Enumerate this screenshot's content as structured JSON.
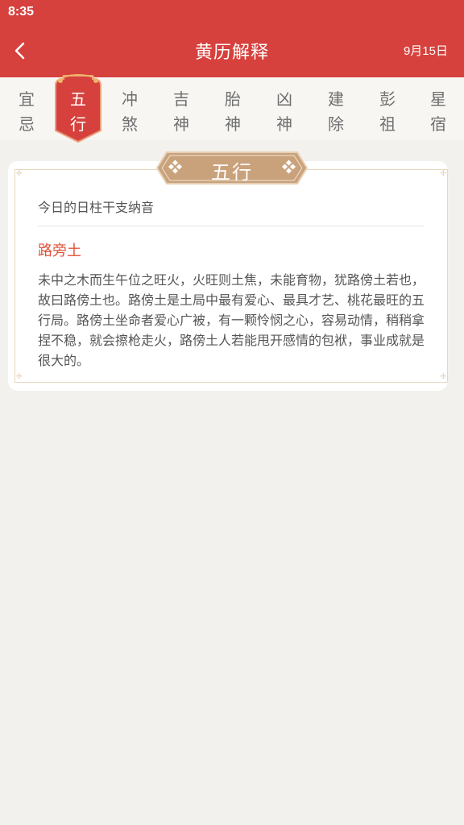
{
  "status_bar": {
    "time": "8:35"
  },
  "header": {
    "title": "黄历解释",
    "date": "9月15日"
  },
  "tabs": [
    {
      "c1": "宜",
      "c2": "忌"
    },
    {
      "c1": "五",
      "c2": "行"
    },
    {
      "c1": "冲",
      "c2": "煞"
    },
    {
      "c1": "吉",
      "c2": "神"
    },
    {
      "c1": "胎",
      "c2": "神"
    },
    {
      "c1": "凶",
      "c2": "神"
    },
    {
      "c1": "建",
      "c2": "除"
    },
    {
      "c1": "彭",
      "c2": "祖"
    },
    {
      "c1": "星",
      "c2": "宿"
    }
  ],
  "active_tab_index": 1,
  "card": {
    "badge": "五行",
    "subtitle": "今日的日柱干支纳音",
    "name": "路旁土",
    "description": "未中之木而生午位之旺火，火旺则土焦，未能育物，犹路傍土若也，故曰路傍土也。路傍土是土局中最有爱心、最具才艺、桃花最旺的五行局。路傍土坐命者爱心广被，有一颗怜悯之心，容易动情，稍稍拿捏不稳，就会擦枪走火，路傍土人若能甩开感情的包袱，事业成就是很大的。"
  },
  "colors": {
    "brand_red": "#d6413d",
    "highlight_text": "#e0533a",
    "badge_tan": "#c9a27c"
  }
}
